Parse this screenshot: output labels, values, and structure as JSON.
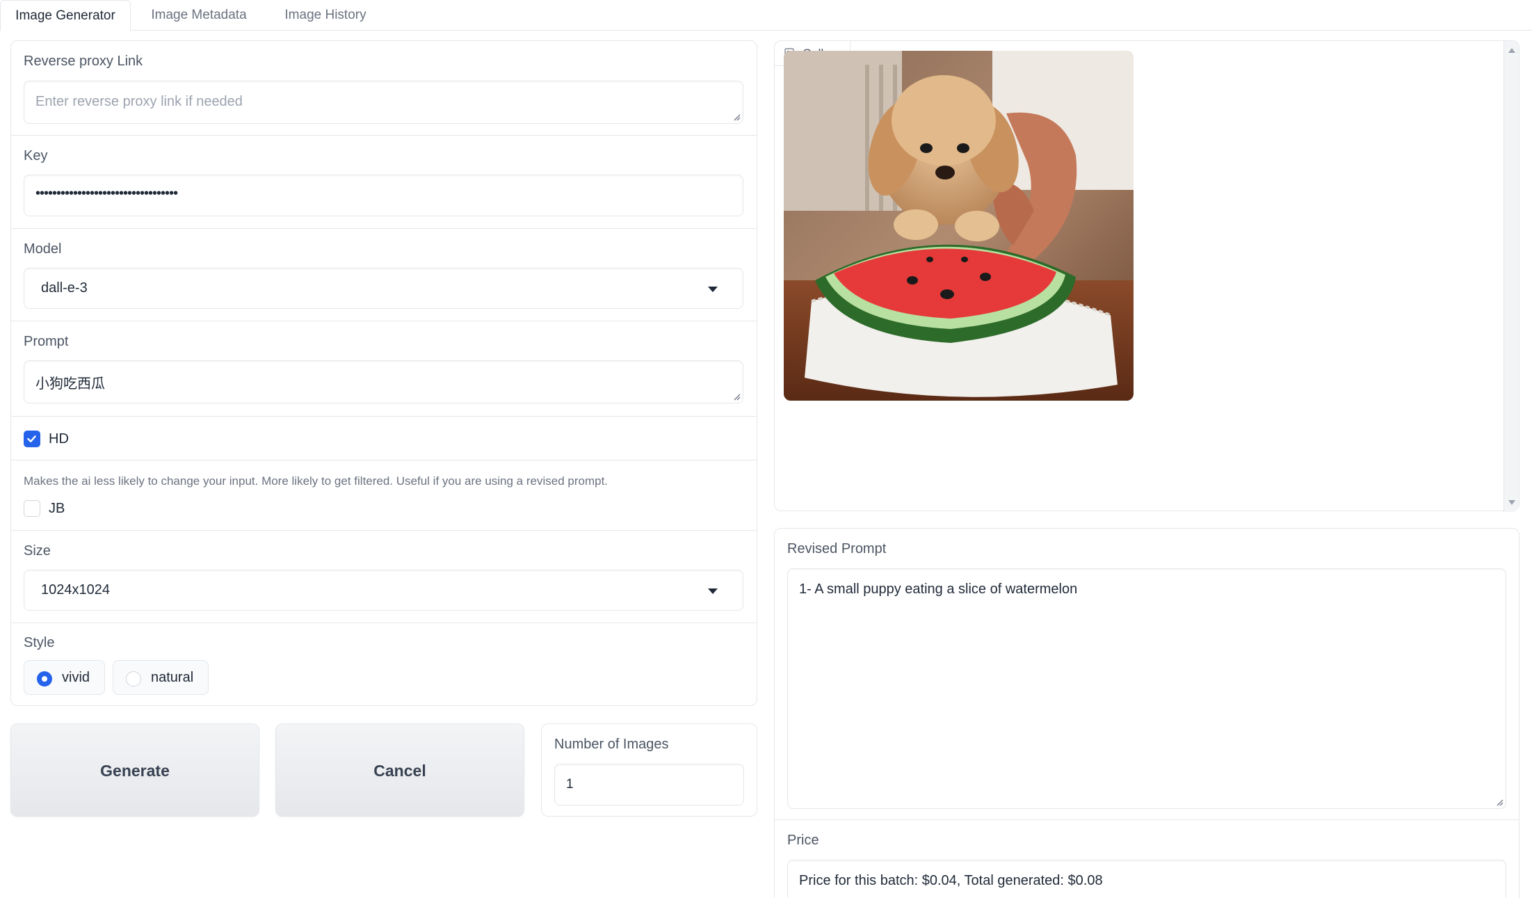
{
  "tabs": [
    {
      "label": "Image Generator",
      "active": true
    },
    {
      "label": "Image Metadata",
      "active": false
    },
    {
      "label": "Image History",
      "active": false
    }
  ],
  "form": {
    "proxy": {
      "label": "Reverse proxy Link",
      "placeholder": "Enter reverse proxy link if needed",
      "value": ""
    },
    "key": {
      "label": "Key",
      "value": "••••••••••••••••••••••••••••••••••"
    },
    "model": {
      "label": "Model",
      "value": "dall-e-3"
    },
    "prompt": {
      "label": "Prompt",
      "value": "小狗吃西瓜"
    },
    "hd": {
      "label": "HD",
      "checked": true
    },
    "jb": {
      "info": "Makes the ai less likely to change your input. More likely to get filtered. Useful if you are using a revised prompt.",
      "label": "JB",
      "checked": false
    },
    "size": {
      "label": "Size",
      "value": "1024x1024"
    },
    "style": {
      "label": "Style",
      "options": [
        "vivid",
        "natural"
      ],
      "selected": "vivid"
    }
  },
  "actions": {
    "generate": "Generate",
    "cancel": "Cancel"
  },
  "num_images": {
    "label": "Number of Images",
    "value": "1"
  },
  "gallery": {
    "label": "Gallery"
  },
  "revised_prompt": {
    "label": "Revised Prompt",
    "value": "1- A small puppy eating a slice of watermelon"
  },
  "price": {
    "label": "Price",
    "value": "Price for this batch: $0.04, Total generated: $0.08"
  },
  "colors": {
    "accent": "#2563eb",
    "border": "#e5e7eb"
  }
}
